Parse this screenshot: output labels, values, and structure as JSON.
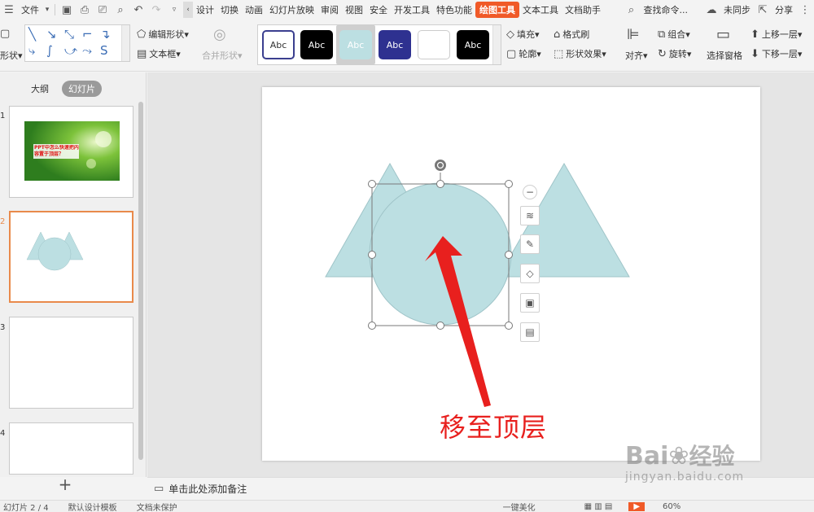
{
  "menubar": {
    "file_label": "文件",
    "tabs": [
      "设计",
      "切换",
      "动画",
      "幻灯片放映",
      "审阅",
      "视图",
      "安全",
      "开发工具",
      "特色功能"
    ],
    "active_tab": "绘图工具",
    "tabs_after": [
      "文本工具",
      "文档助手"
    ],
    "search_label": "查找命令...",
    "sync_label": "未同步",
    "share_label": "分享"
  },
  "ribbon": {
    "shape_label": "形状",
    "edit_shape": "编辑形状",
    "text_box": "文本框",
    "merge_shape": "合并形状",
    "styles": [
      "Abc",
      "Abc",
      "Abc",
      "Abc",
      "",
      "Abc"
    ],
    "fill": "填充",
    "format_brush": "格式刷",
    "outline": "轮廓",
    "shape_effect": "形状效果",
    "align": "对齐",
    "group": "组合",
    "rotate": "旋转",
    "selection_pane": "选择窗格",
    "bring_forward": "上移一层",
    "send_backward": "下移一层"
  },
  "left_panel": {
    "tab_outline": "大纲",
    "tab_slides": "幻灯片",
    "slide_numbers": [
      "1",
      "2",
      "3",
      "4"
    ],
    "slide1_caption": "PPT中怎么快速把内容置于顶层？"
  },
  "slide": {
    "annotation": "移至顶层",
    "shape_fill": "#bcdfe2",
    "accent": "#e8201e"
  },
  "notes": {
    "placeholder": "单击此处添加备注"
  },
  "statusbar": {
    "slide_info": "幻灯片 2 / 4",
    "theme": "默认设计模板",
    "doc_status": "文档未保护",
    "beautify": "一键美化",
    "zoom": "60%"
  },
  "watermark": {
    "brand": "Bai",
    "brand_cn": "经验",
    "url": "jingyan.baidu.com"
  },
  "colors": {
    "active_tab_bg": "#f05a28",
    "selected_thumb_border": "#e98a4b"
  }
}
